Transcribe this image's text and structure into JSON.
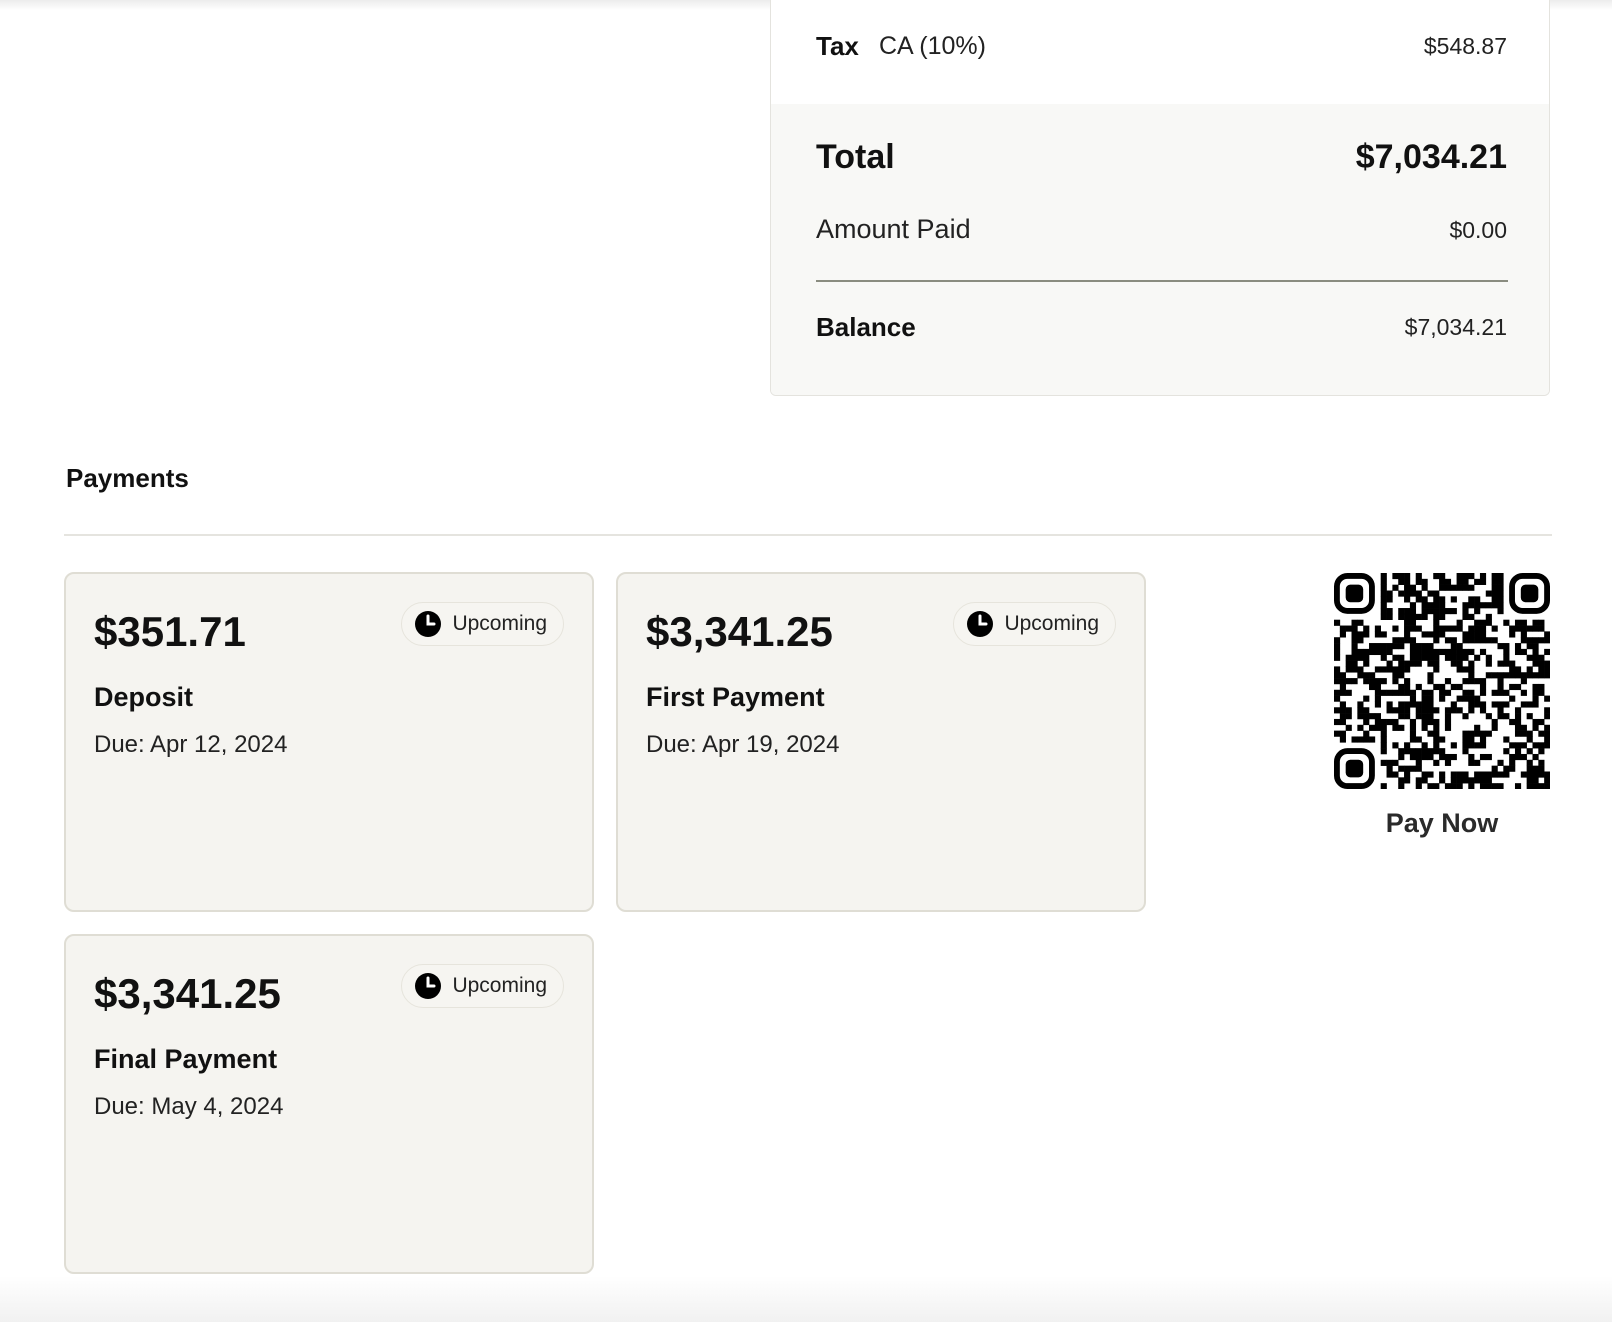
{
  "summary": {
    "tax_label": "Tax",
    "tax_region": "CA (10%)",
    "tax_amount": "$548.87",
    "total_label": "Total",
    "total_amount": "$7,034.21",
    "amount_paid_label": "Amount Paid",
    "amount_paid": "$0.00",
    "balance_label": "Balance",
    "balance_amount": "$7,034.21"
  },
  "payments": {
    "title": "Payments",
    "items": [
      {
        "amount": "$351.71",
        "name": "Deposit",
        "due": "Due: Apr 12, 2024",
        "status": "Upcoming",
        "status_icon": "clock-icon"
      },
      {
        "amount": "$3,341.25",
        "name": "First Payment",
        "due": "Due: Apr 19, 2024",
        "status": "Upcoming",
        "status_icon": "clock-icon"
      },
      {
        "amount": "$3,341.25",
        "name": "Final Payment",
        "due": "Due: May 4, 2024",
        "status": "Upcoming",
        "status_icon": "clock-icon"
      }
    ]
  },
  "qr": {
    "icon": "qr-code-icon",
    "label": "Pay Now"
  },
  "colors": {
    "card_bg": "#f5f4f0",
    "summary_bg": "#f8f8f6",
    "divider": "#8a8c80",
    "text": "#111111"
  }
}
